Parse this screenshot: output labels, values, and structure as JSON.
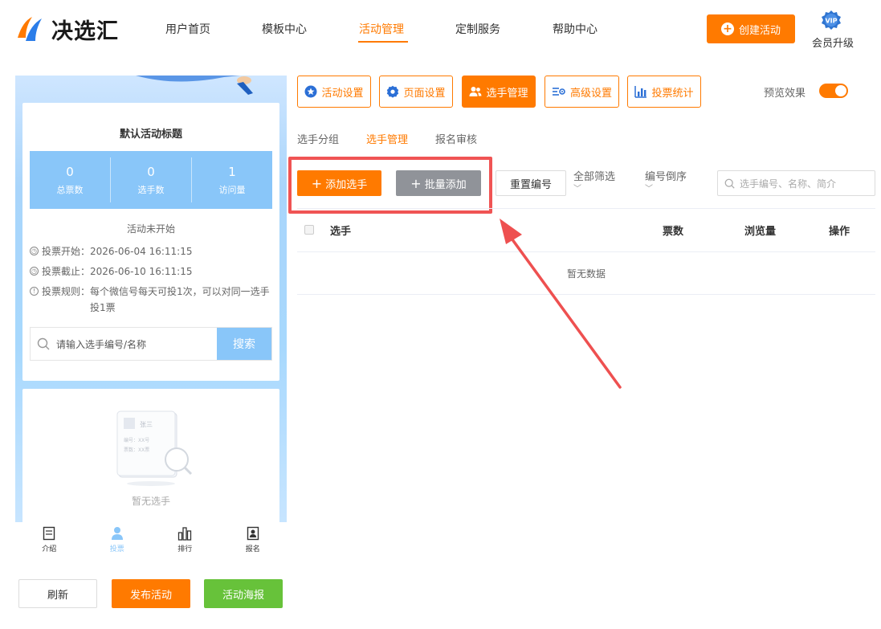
{
  "header": {
    "logo_text": "决选汇",
    "nav": [
      "用户首页",
      "模板中心",
      "活动管理",
      "定制服务",
      "帮助中心"
    ],
    "active_nav": "活动管理",
    "create_button": "创建活动",
    "vip_badge": "VIP",
    "vip_label": "会员升级"
  },
  "preview": {
    "title": "默认活动标题",
    "stats": [
      {
        "value": "0",
        "label": "总票数"
      },
      {
        "value": "0",
        "label": "选手数"
      },
      {
        "value": "1",
        "label": "访问量"
      }
    ],
    "status": "活动未开始",
    "vote_start_label": "投票开始：",
    "vote_start": "2026-06-04 16:11:15",
    "vote_end_label": "投票截止：",
    "vote_end": "2026-06-10 16:11:15",
    "vote_rule_label": "投票规则：",
    "vote_rule": "每个微信号每天可投1次，可以对同一选手投1票",
    "search_placeholder": "请输入选手编号/名称",
    "search_button": "搜索",
    "empty_text": "暂无选手",
    "illustration": {
      "name": "张三",
      "line1": "编号：XX号",
      "line2": "票数：XX票"
    },
    "tabbar": [
      {
        "label": "介绍",
        "icon": "document-icon"
      },
      {
        "label": "投票",
        "icon": "user-icon"
      },
      {
        "label": "排行",
        "icon": "ranking-icon"
      },
      {
        "label": "报名",
        "icon": "signup-icon"
      }
    ],
    "active_tab": "投票"
  },
  "bottom_buttons": {
    "refresh": "刷新",
    "publish": "发布活动",
    "poster": "活动海报"
  },
  "toolbar": {
    "buttons": [
      "活动设置",
      "页面设置",
      "选手管理",
      "高级设置",
      "投票统计"
    ],
    "active": "选手管理",
    "preview_label": "预览效果",
    "preview_on": true
  },
  "subtabs": [
    "选手分组",
    "选手管理",
    "报名审核"
  ],
  "active_subtab": "选手管理",
  "actions": {
    "add": "添加选手",
    "batch": "批量添加",
    "reset": "重置编号",
    "filter": "全部筛选",
    "sort": "编号倒序",
    "search_placeholder": "选手编号、名称、简介"
  },
  "table": {
    "columns": [
      "选手",
      "票数",
      "浏览量",
      "操作"
    ],
    "empty": "暂无数据"
  },
  "colors": {
    "accent": "#ff7a00",
    "preview_blue": "#89c6f9",
    "green": "#67c23a",
    "highlight": "#f05454"
  }
}
